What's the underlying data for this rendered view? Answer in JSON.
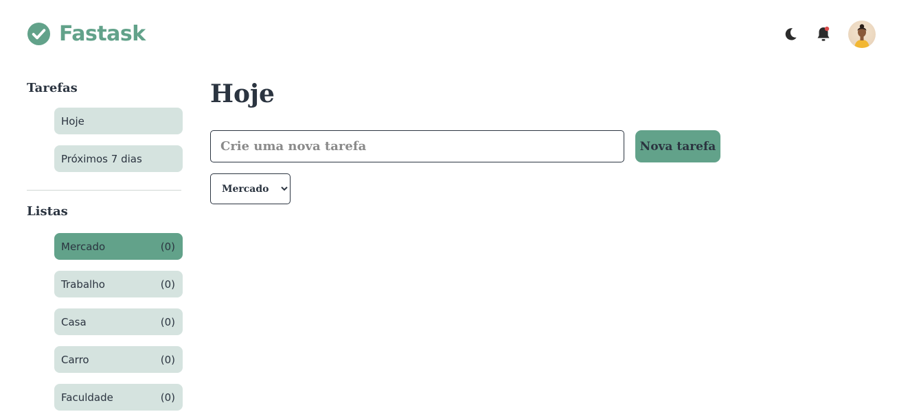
{
  "app": {
    "name": "Fastask",
    "brand_color": "#62a28a"
  },
  "header": {
    "icons": [
      "check-circle-icon",
      "moon-icon",
      "bell-icon",
      "avatar"
    ]
  },
  "sidebar": {
    "tarefas_title": "Tarefas",
    "tarefas": [
      {
        "label": "Hoje"
      },
      {
        "label": "Próximos 7 dias"
      }
    ],
    "listas_title": "Listas",
    "listas": [
      {
        "label": "Mercado",
        "count": "(0)",
        "active": true
      },
      {
        "label": "Trabalho",
        "count": "(0)"
      },
      {
        "label": "Casa",
        "count": "(0)"
      },
      {
        "label": "Carro",
        "count": "(0)"
      },
      {
        "label": "Faculdade",
        "count": "(0)"
      }
    ]
  },
  "main": {
    "title": "Hoje",
    "new_task_placeholder": "Crie uma nova tarefa",
    "new_task_button": "Nova tarefa",
    "list_select": {
      "selected": "Mercado"
    }
  }
}
